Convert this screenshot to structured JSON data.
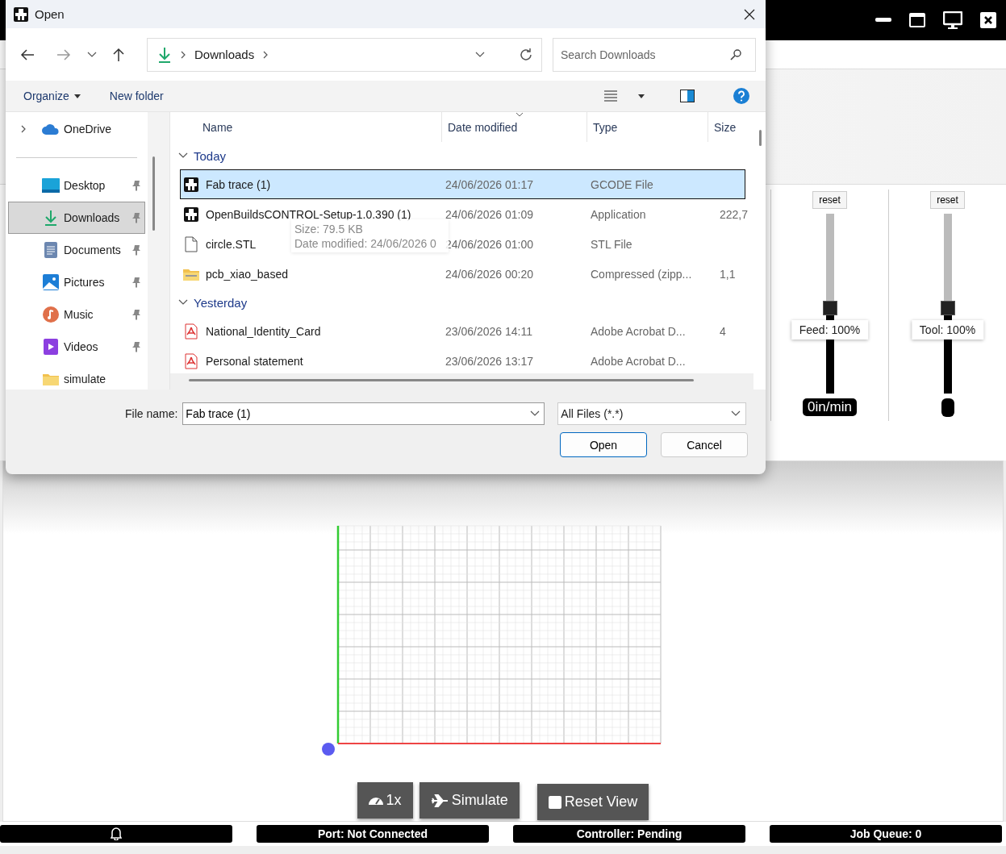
{
  "app": {
    "sliders": [
      {
        "reset": "reset",
        "label": "Feed: 100%",
        "level": 0.47,
        "reading": "0in/min"
      },
      {
        "reset": "reset",
        "label": "Tool: 100%",
        "level": 0.47
      }
    ],
    "viewer": {
      "buttons": [
        {
          "kind": "speed",
          "label": "1x"
        },
        {
          "kind": "simulate",
          "label": "Simulate"
        },
        {
          "kind": "reset",
          "label": "Reset View"
        }
      ]
    },
    "status_bar": [
      {
        "kind": "bell"
      },
      {
        "kind": "text",
        "label": "Port: Not Connected"
      },
      {
        "kind": "text",
        "label": "Controller: Pending"
      },
      {
        "kind": "text",
        "label": "Job Queue: 0"
      }
    ]
  },
  "dialog": {
    "title": "Open",
    "address": [
      "Downloads"
    ],
    "search": {
      "placeholder": "Search Downloads"
    },
    "toolbar": [
      {
        "label": "Organize",
        "menu": true
      },
      {
        "label": "New folder",
        "menu": false
      }
    ],
    "sidebar": [
      {
        "kind": "cloud",
        "label": "OneDrive",
        "expanded": false,
        "selected": false
      },
      {
        "kind": "desktop",
        "label": "Desktop",
        "pinned": true,
        "selected": false
      },
      {
        "kind": "download",
        "label": "Downloads",
        "pinned": true,
        "selected": true
      },
      {
        "kind": "documents",
        "label": "Documents",
        "pinned": true,
        "selected": false
      },
      {
        "kind": "pictures",
        "label": "Pictures",
        "pinned": true,
        "selected": false
      },
      {
        "kind": "music",
        "label": "Music",
        "pinned": true,
        "selected": false
      },
      {
        "kind": "videos",
        "label": "Videos",
        "pinned": true,
        "selected": false
      },
      {
        "kind": "folder",
        "label": "simulate",
        "pinned": false,
        "selected": false
      }
    ],
    "columns": [
      "Name",
      "Date modified",
      "Type",
      "Size"
    ],
    "groups": [
      {
        "label": "Today",
        "expanded": true,
        "rows": [
          {
            "kind": "app",
            "name": "Fab trace (1)",
            "date": "24/06/2026 01:17",
            "type": "GCODE File",
            "selected": true
          },
          {
            "kind": "app",
            "name": "OpenBuildsCONTROL-Setup-1.0.390 (1)",
            "date": "24/06/2026 01:09",
            "type": "Application",
            "size": "222,7",
            "selected": false
          },
          {
            "kind": "blank",
            "name": "circle.STL",
            "date": "24/06/2026 01:00",
            "type": "STL File",
            "selected": false
          },
          {
            "kind": "zip",
            "name": "pcb_xiao_based",
            "date": "24/06/2026 00:20",
            "type": "Compressed (zipp...",
            "size": "1,1",
            "selected": false
          }
        ]
      },
      {
        "label": "Yesterday",
        "expanded": true,
        "rows": [
          {
            "kind": "pdf",
            "name": "National_Identity_Card",
            "date": "23/06/2026 14:11",
            "type": "Adobe Acrobat D...",
            "size": "4",
            "selected": false
          },
          {
            "kind": "pdf",
            "name": "Personal statement",
            "date": "23/06/2026 13:17",
            "type": "Adobe Acrobat D...",
            "selected": false
          }
        ]
      }
    ],
    "tooltip": [
      "Size: 79.5 KB",
      "Date modified: 24/06/2026 0"
    ],
    "file_name": {
      "label": "File name:",
      "value": "Fab trace (1)"
    },
    "filter": "All Files (*.*)",
    "buttons": [
      "Open",
      "Cancel"
    ]
  }
}
